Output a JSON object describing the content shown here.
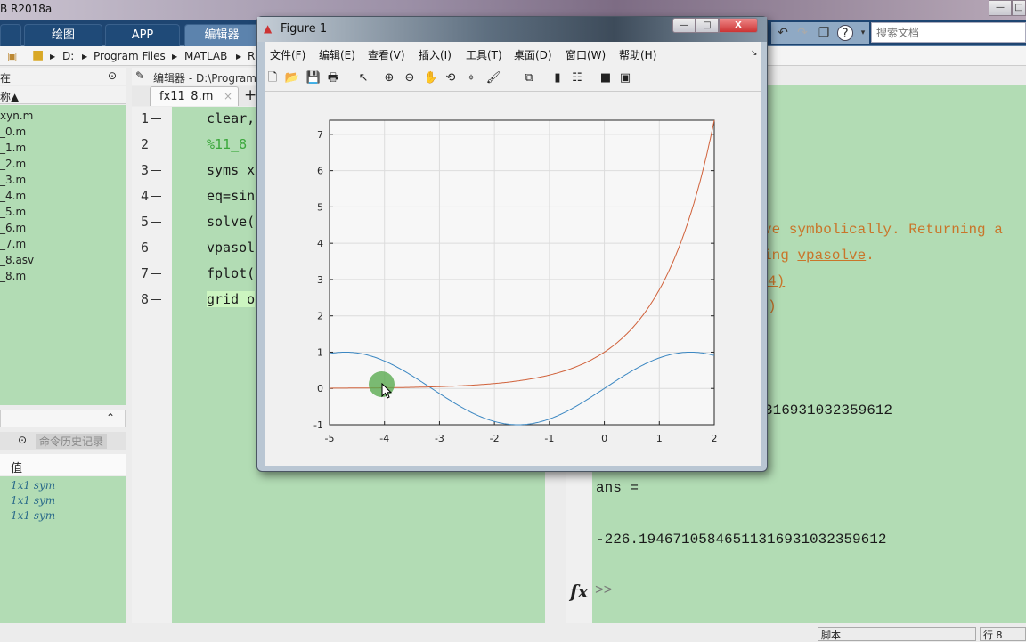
{
  "app": {
    "title": "B R2018a"
  },
  "ribbon": {
    "tabs": [
      {
        "label": "绘图"
      },
      {
        "label": "APP"
      },
      {
        "label": "编辑器"
      }
    ],
    "search_placeholder": "搜索文档"
  },
  "address": {
    "path": [
      "D:",
      "Program Files",
      "MATLAB",
      "R"
    ]
  },
  "file_browser": {
    "header": "在",
    "sort_label": "称▲",
    "files": [
      "xyn.m",
      "_0.m",
      "_1.m",
      "_2.m",
      "_3.m",
      "_4.m",
      "_5.m",
      "_6.m",
      "_7.m",
      "_8.asv",
      "_8.m"
    ]
  },
  "workspace": {
    "history_tab": "命令历史记录",
    "value_header": "值",
    "values": [
      "1x1 sym",
      "1x1 sym",
      "1x1 sym"
    ]
  },
  "editor": {
    "title": "编辑器 - D:\\Program",
    "tab": "fx11_8.m",
    "lines": [
      {
        "n": "1",
        "code": "clear,",
        "type": "code"
      },
      {
        "n": "2",
        "code": "%11_8",
        "type": "comment"
      },
      {
        "n": "3",
        "code": "syms x",
        "type": "code"
      },
      {
        "n": "4",
        "code": "eq=sin",
        "type": "code"
      },
      {
        "n": "5",
        "code": "solve(",
        "type": "code"
      },
      {
        "n": "6",
        "code": "vpasol",
        "type": "code"
      },
      {
        "n": "7",
        "code": "fplot(",
        "type": "code"
      },
      {
        "n": "8",
        "code": "grid o",
        "type": "code"
      }
    ]
  },
  "command_window": {
    "warn1": "ve symbolically. Returning a",
    "warn2a": "ing ",
    "warn2link": "vpasolve",
    "warn2b": ".",
    "link3": "4)",
    "link4": ")",
    "result1": "316931032359612",
    "ans_label": "ans =",
    "result2": "-226.19467105846511316931032359612",
    "prompt": ">>",
    "fx": "fx"
  },
  "status": {
    "type": "脚本",
    "row_label": "行",
    "row": "8"
  },
  "figure": {
    "title": "Figure 1",
    "menu": [
      "文件(F)",
      "编辑(E)",
      "查看(V)",
      "插入(I)",
      "工具(T)",
      "桌面(D)",
      "窗口(W)",
      "帮助(H)"
    ],
    "toolbar_icons": [
      "new-figure",
      "open",
      "save",
      "print",
      "select-arrow",
      "zoom-in",
      "zoom-out",
      "pan-hand",
      "rotate-3d",
      "data-cursor",
      "brush",
      "link-plot",
      "colorbar",
      "legend",
      "hide-plot-tools",
      "show-plot-tools"
    ]
  },
  "chart_data": {
    "type": "line",
    "xlim": [
      -5,
      2
    ],
    "ylim": [
      -1,
      7.389
    ],
    "xticks": [
      "-5",
      "-4",
      "-3",
      "-2",
      "-1",
      "0",
      "1",
      "2"
    ],
    "yticks": [
      "-1",
      "0",
      "1",
      "2",
      "3",
      "4",
      "5",
      "6",
      "7"
    ],
    "grid": true,
    "series": [
      {
        "function": "sin(x)",
        "color": "#3b87c2"
      },
      {
        "function": "exp(x)",
        "color": "#d0613a"
      }
    ]
  }
}
